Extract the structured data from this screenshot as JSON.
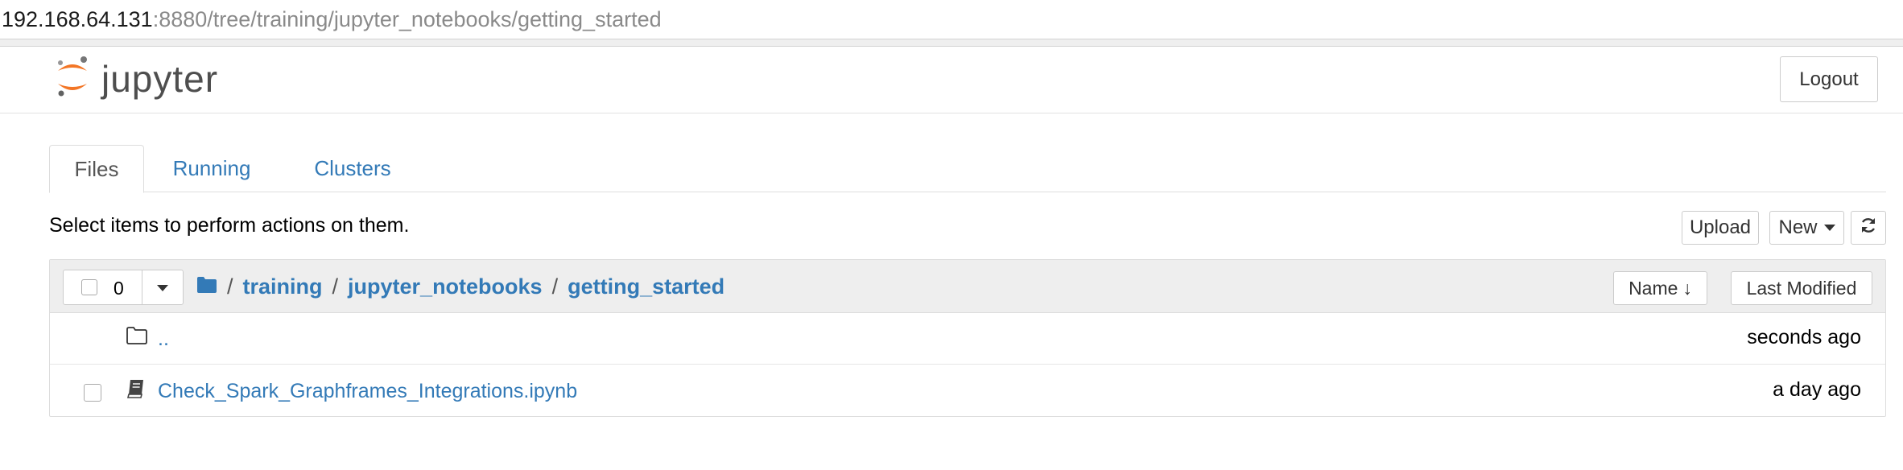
{
  "browser": {
    "url_host": "192.168.64.131",
    "url_path": ":8880/tree/training/jupyter_notebooks/getting_started"
  },
  "header": {
    "logo_text": "jupyter",
    "logout_label": "Logout",
    "brand_color": "#F37626"
  },
  "tabs": [
    {
      "label": "Files",
      "active": true
    },
    {
      "label": "Running",
      "active": false
    },
    {
      "label": "Clusters",
      "active": false
    }
  ],
  "toolbar": {
    "hint": "Select items to perform actions on them.",
    "upload_label": "Upload",
    "new_label": "New",
    "refresh_icon": "refresh-icon"
  },
  "file_list": {
    "selected_count": "0",
    "breadcrumb": [
      {
        "label": "/",
        "type": "root"
      },
      {
        "label": "training"
      },
      {
        "label": "jupyter_notebooks"
      },
      {
        "label": "getting_started"
      }
    ],
    "sort_name_label": "Name",
    "sort_modified_label": "Last Modified",
    "rows": [
      {
        "name": "..",
        "icon": "folder-icon",
        "modified": "seconds ago",
        "has_checkbox": false
      },
      {
        "name": "Check_Spark_Graphframes_Integrations.ipynb",
        "icon": "notebook-icon",
        "modified": "a day ago",
        "has_checkbox": true
      }
    ]
  },
  "colors": {
    "link": "#337ab7",
    "header_bg": "#eeeeee"
  }
}
